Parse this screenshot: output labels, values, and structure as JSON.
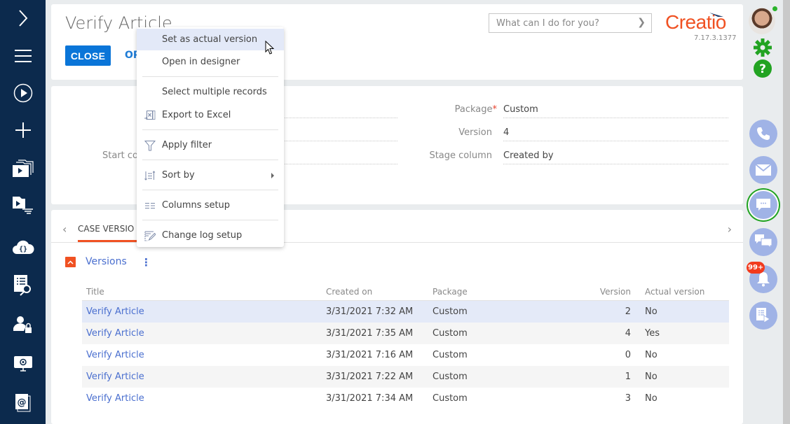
{
  "leftnav": {
    "items": [
      {
        "icon": "expand-chevron-icon"
      },
      {
        "icon": "menu-icon"
      },
      {
        "icon": "play-icon"
      },
      {
        "icon": "plus-icon"
      },
      {
        "icon": "folders-icon"
      },
      {
        "icon": "process-log-icon"
      },
      {
        "icon": "cloud-code-icon"
      },
      {
        "icon": "document-search-icon"
      },
      {
        "icon": "user-lock-icon"
      },
      {
        "icon": "monitor-gear-icon"
      },
      {
        "icon": "email-template-icon"
      }
    ]
  },
  "header": {
    "title": "Verify Article",
    "close_label": "CLOSE",
    "open_label_partial": "OP",
    "search_placeholder": "What can I do for you?",
    "logo_text": "Creatio",
    "version": "7.17.3.1377"
  },
  "info": {
    "left_fields": [
      {
        "label": "Start con",
        "value": ""
      }
    ],
    "right_fields": [
      {
        "label": "Package",
        "required": "*",
        "value": "Custom"
      },
      {
        "label": "Version",
        "required": "",
        "value": "4"
      },
      {
        "label": "Stage column",
        "required": "",
        "value": "Created by"
      }
    ]
  },
  "detail": {
    "tab_label": "CASE VERSIO",
    "section_title": "Versions",
    "kebab": "⋮",
    "columns": [
      "Title",
      "Created on",
      "Package",
      "Version",
      "Actual version"
    ],
    "rows": [
      {
        "title": "Verify Article",
        "created_on": "3/31/2021 7:32 AM",
        "package": "Custom",
        "version": "2",
        "actual": "No",
        "selected": true
      },
      {
        "title": "Verify Article",
        "created_on": "3/31/2021 7:35 AM",
        "package": "Custom",
        "version": "4",
        "actual": "Yes",
        "selected": false
      },
      {
        "title": "Verify Article",
        "created_on": "3/31/2021 7:16 AM",
        "package": "Custom",
        "version": "0",
        "actual": "No",
        "selected": false
      },
      {
        "title": "Verify Article",
        "created_on": "3/31/2021 7:22 AM",
        "package": "Custom",
        "version": "1",
        "actual": "No",
        "selected": false
      },
      {
        "title": "Verify Article",
        "created_on": "3/31/2021 7:34 AM",
        "package": "Custom",
        "version": "3",
        "actual": "No",
        "selected": false
      }
    ]
  },
  "context_menu": {
    "items": [
      {
        "label": "Set as actual version",
        "icon": "",
        "hover": true
      },
      {
        "label": "Open in designer",
        "icon": ""
      },
      {
        "label": "Select multiple records",
        "icon": ""
      },
      {
        "label": "Export to Excel",
        "icon": "excel-export-icon"
      },
      {
        "label": "Apply filter",
        "icon": "filter-icon"
      },
      {
        "label": "Sort by",
        "icon": "sort-icon",
        "submenu": true
      },
      {
        "label": "Columns setup",
        "icon": "columns-icon"
      },
      {
        "label": "Change log setup",
        "icon": "change-log-icon"
      }
    ]
  },
  "rightrail": {
    "notification_badge": "99+",
    "buttons": [
      "phone-icon",
      "email-icon",
      "chat-icon",
      "feed-icon",
      "bell-icon",
      "process-icon"
    ],
    "colors": {
      "accent_green": "#22a322",
      "rail_blue": "#a0b3e6",
      "brand_orange": "#f05122",
      "primary_blue": "#0a75d8"
    }
  }
}
